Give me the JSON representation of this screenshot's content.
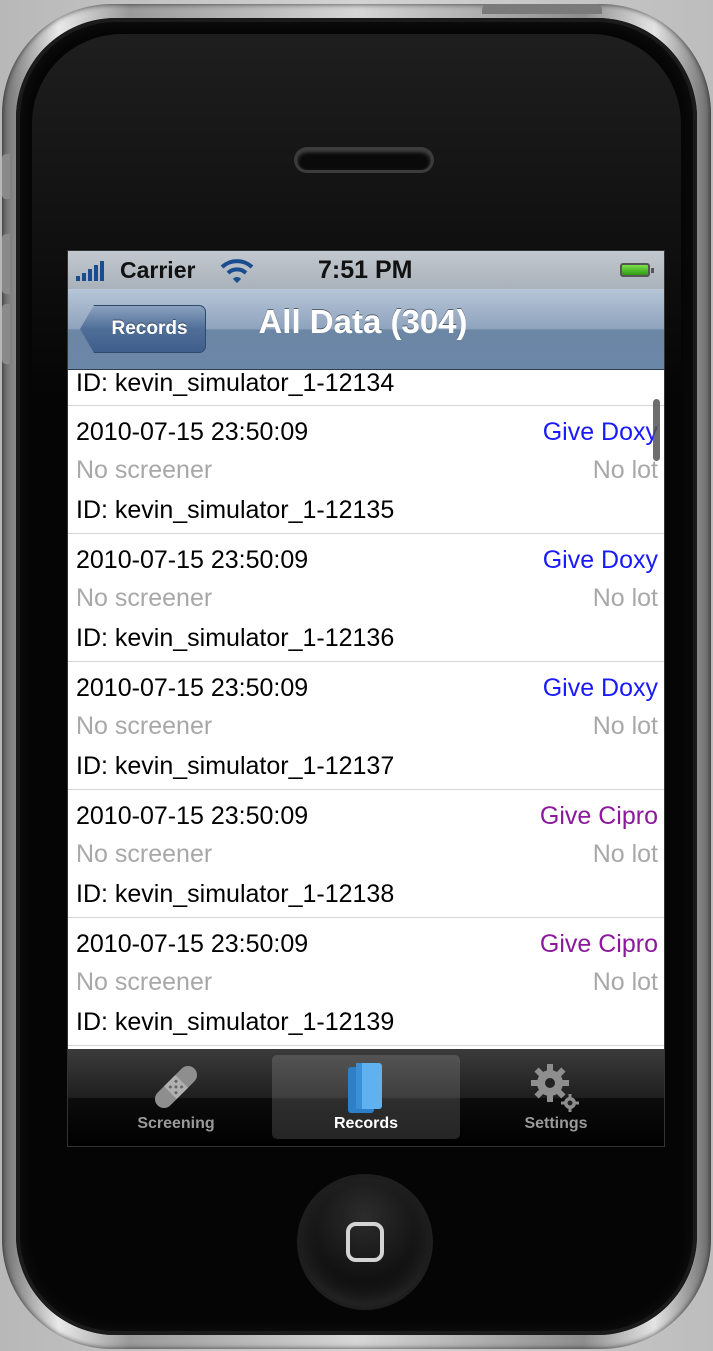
{
  "status_bar": {
    "carrier": "Carrier",
    "time": "7:51 PM"
  },
  "nav": {
    "back_label": "Records",
    "title": "All Data (304)"
  },
  "list": {
    "partial_top_id": "ID: kevin_simulator_1-12134",
    "rows": [
      {
        "date": "2010-07-15 23:50:09",
        "action": "Give Doxy",
        "action_color": "#1a1aff",
        "screener": "No screener",
        "lot": "No lot",
        "id": "ID: kevin_simulator_1-12135"
      },
      {
        "date": "2010-07-15 23:50:09",
        "action": "Give Doxy",
        "action_color": "#1a1aff",
        "screener": "No screener",
        "lot": "No lot",
        "id": "ID: kevin_simulator_1-12136"
      },
      {
        "date": "2010-07-15 23:50:09",
        "action": "Give Doxy",
        "action_color": "#1a1aff",
        "screener": "No screener",
        "lot": "No lot",
        "id": "ID: kevin_simulator_1-12137"
      },
      {
        "date": "2010-07-15 23:50:09",
        "action": "Give Cipro",
        "action_color": "#8a1a9a",
        "screener": "No screener",
        "lot": "No lot",
        "id": "ID: kevin_simulator_1-12138"
      },
      {
        "date": "2010-07-15 23:50:09",
        "action": "Give Cipro",
        "action_color": "#8a1a9a",
        "screener": "No screener",
        "lot": "No lot",
        "id": "ID: kevin_simulator_1-12139"
      }
    ]
  },
  "tabs": [
    {
      "label": "Screening",
      "icon": "bandage-icon",
      "active": false
    },
    {
      "label": "Records",
      "icon": "books-icon",
      "active": true
    },
    {
      "label": "Settings",
      "icon": "gears-icon",
      "active": false
    }
  ]
}
